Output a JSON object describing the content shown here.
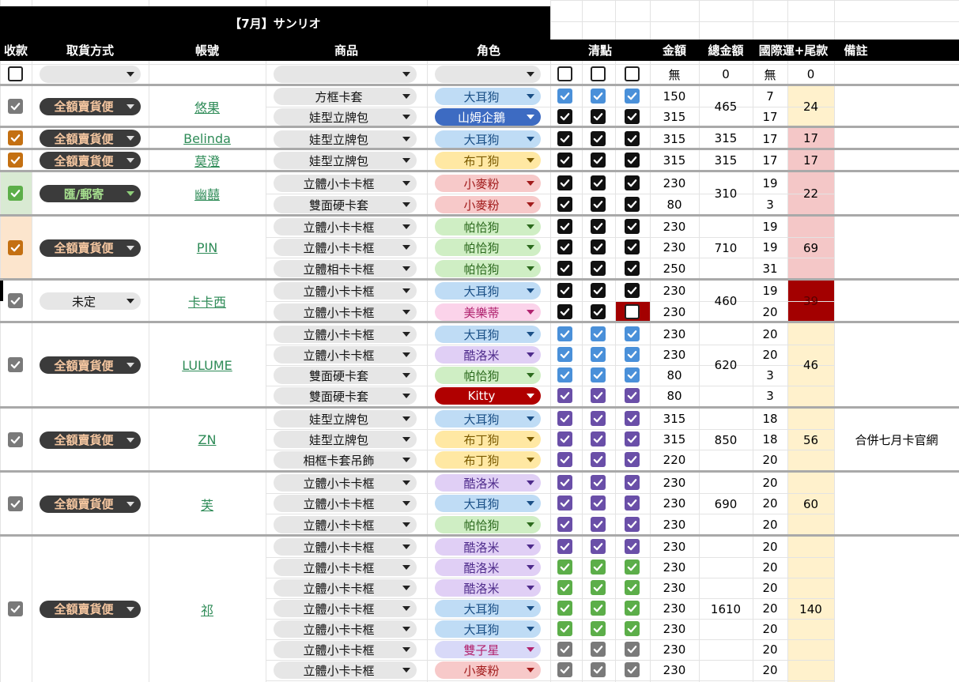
{
  "title": "【7月】サンリオ",
  "headers": [
    "收款",
    "取貨方式",
    "帳號",
    "商品",
    "角色",
    "清點",
    "金額",
    "總金額",
    "國際運+尾款",
    "備註"
  ],
  "empty_row": {
    "amount": "無",
    "total": "0",
    "shipping": "無",
    "tail": "0"
  },
  "colors": {
    "blue": "#4a90d9",
    "purple": "#6a4fa8",
    "green": "#5cae49",
    "black": "#111",
    "gray": "#7a7a7a",
    "orange": "#c47012",
    "yellow_bg": "#fff1cc",
    "pink_bg": "#f4c7c7",
    "red_bg": "#a30000"
  },
  "groups": [
    {
      "paid": "gray",
      "paid_bg": "",
      "pickup": "全額賣貨便",
      "pickup_style": "dark",
      "account": "悠果",
      "total": "465",
      "tail": "24",
      "tail_style": "yellow",
      "note": "",
      "items": [
        {
          "product": "方框卡套",
          "role": "大耳狗",
          "role_style": "blue",
          "checks": [
            "blue",
            "blue",
            "blue"
          ],
          "amount": "150",
          "ship": "7"
        },
        {
          "product": "娃型立牌包",
          "role": "山姆企鵝",
          "role_style": "darkblue",
          "checks": [
            "black",
            "black",
            "black"
          ],
          "amount": "315",
          "ship": "17"
        }
      ]
    },
    {
      "paid": "orange",
      "paid_bg": "",
      "pickup": "全額賣貨便",
      "pickup_style": "dark",
      "account": "Belinda",
      "total": "315",
      "tail": "17",
      "tail_style": "pink",
      "note": "",
      "items": [
        {
          "product": "娃型立牌包",
          "role": "大耳狗",
          "role_style": "blue",
          "checks": [
            "black",
            "black",
            "black"
          ],
          "amount": "315",
          "ship": "17"
        }
      ]
    },
    {
      "paid": "orange",
      "paid_bg": "",
      "pickup": "全額賣貨便",
      "pickup_style": "dark",
      "account": "莫澄",
      "total": "315",
      "tail": "17",
      "tail_style": "pink",
      "note": "",
      "items": [
        {
          "product": "娃型立牌包",
          "role": "布丁狗",
          "role_style": "yellow",
          "checks": [
            "black",
            "black",
            "black"
          ],
          "amount": "315",
          "ship": "17"
        }
      ]
    },
    {
      "paid": "green",
      "paid_bg": "#d9ead3",
      "pickup": "匯/郵寄",
      "pickup_style": "darkgreen",
      "account": "幽囍",
      "total": "310",
      "tail": "22",
      "tail_style": "pink",
      "note": "",
      "items": [
        {
          "product": "立體小卡卡框",
          "role": "小麥粉",
          "role_style": "pink",
          "checks": [
            "black",
            "black",
            "black"
          ],
          "amount": "230",
          "ship": "19"
        },
        {
          "product": "雙面硬卡套",
          "role": "小麥粉",
          "role_style": "pink",
          "checks": [
            "black",
            "black",
            "black"
          ],
          "amount": "80",
          "ship": "3"
        }
      ]
    },
    {
      "paid": "orange",
      "paid_bg": "#fce5cd",
      "pickup": "全額賣貨便",
      "pickup_style": "dark",
      "account": "PIN",
      "total": "710",
      "tail": "69",
      "tail_style": "pink",
      "note": "",
      "items": [
        {
          "product": "立體小卡卡框",
          "role": "帕恰狗",
          "role_style": "green",
          "checks": [
            "black",
            "black",
            "black"
          ],
          "amount": "230",
          "ship": "19"
        },
        {
          "product": "立體小卡卡框",
          "role": "帕恰狗",
          "role_style": "green",
          "checks": [
            "black",
            "black",
            "black"
          ],
          "amount": "230",
          "ship": "19"
        },
        {
          "product": "立體相卡卡框",
          "role": "帕恰狗",
          "role_style": "green",
          "checks": [
            "black",
            "black",
            "black"
          ],
          "amount": "250",
          "ship": "31"
        }
      ]
    },
    {
      "paid": "gray",
      "paid_bg": "",
      "pickup": "未定",
      "pickup_style": "light",
      "account": "卡卡西",
      "total": "460",
      "tail": "39",
      "tail_style": "red",
      "note": "",
      "items": [
        {
          "product": "立體小卡卡框",
          "role": "大耳狗",
          "role_style": "blue",
          "checks": [
            "black",
            "black",
            "black"
          ],
          "amount": "230",
          "ship": "19"
        },
        {
          "product": "立體小卡卡框",
          "role": "美樂蒂",
          "role_style": "lightpink",
          "checks": [
            "black",
            "black",
            "redoff"
          ],
          "amount": "230",
          "ship": "20"
        }
      ]
    },
    {
      "paid": "gray",
      "paid_bg": "",
      "pickup": "全額賣貨便",
      "pickup_style": "dark",
      "account": "LULUME",
      "total": "620",
      "tail": "46",
      "tail_style": "yellow",
      "note": "",
      "items": [
        {
          "product": "立體小卡卡框",
          "role": "大耳狗",
          "role_style": "blue",
          "checks": [
            "blue",
            "blue",
            "blue"
          ],
          "amount": "230",
          "ship": "20"
        },
        {
          "product": "立體小卡卡框",
          "role": "酷洛米",
          "role_style": "purple",
          "checks": [
            "blue",
            "blue",
            "blue"
          ],
          "amount": "230",
          "ship": "20"
        },
        {
          "product": "雙面硬卡套",
          "role": "帕恰狗",
          "role_style": "green",
          "checks": [
            "blue",
            "blue",
            "blue"
          ],
          "amount": "80",
          "ship": "3"
        },
        {
          "product": "雙面硬卡套",
          "role": "Kitty",
          "role_style": "red",
          "checks": [
            "purple",
            "purple",
            "purple"
          ],
          "amount": "80",
          "ship": "3"
        }
      ]
    },
    {
      "paid": "gray",
      "paid_bg": "",
      "pickup": "全額賣貨便",
      "pickup_style": "dark",
      "account": "ZN",
      "total": "850",
      "tail": "56",
      "tail_style": "yellow",
      "note": "合併七月卡官網",
      "items": [
        {
          "product": "娃型立牌包",
          "role": "大耳狗",
          "role_style": "blue",
          "checks": [
            "purple",
            "purple",
            "purple"
          ],
          "amount": "315",
          "ship": "18"
        },
        {
          "product": "娃型立牌包",
          "role": "布丁狗",
          "role_style": "yellow",
          "checks": [
            "purple",
            "purple",
            "purple"
          ],
          "amount": "315",
          "ship": "18"
        },
        {
          "product": "相框卡套吊飾",
          "role": "布丁狗",
          "role_style": "yellow",
          "checks": [
            "purple",
            "purple",
            "purple"
          ],
          "amount": "220",
          "ship": "20"
        }
      ]
    },
    {
      "paid": "gray",
      "paid_bg": "",
      "pickup": "全額賣貨便",
      "pickup_style": "dark",
      "account": "芙",
      "total": "690",
      "tail": "60",
      "tail_style": "yellow",
      "note": "",
      "items": [
        {
          "product": "立體小卡卡框",
          "role": "酷洛米",
          "role_style": "purple",
          "checks": [
            "purple",
            "purple",
            "purple"
          ],
          "amount": "230",
          "ship": "20"
        },
        {
          "product": "立體小卡卡框",
          "role": "大耳狗",
          "role_style": "blue",
          "checks": [
            "purple",
            "purple",
            "purple"
          ],
          "amount": "230",
          "ship": "20"
        },
        {
          "product": "立體小卡卡框",
          "role": "帕恰狗",
          "role_style": "green",
          "checks": [
            "purple",
            "purple",
            "purple"
          ],
          "amount": "230",
          "ship": "20"
        }
      ]
    },
    {
      "paid": "gray",
      "paid_bg": "",
      "pickup": "全額賣貨便",
      "pickup_style": "dark",
      "account": "祁",
      "total": "1610",
      "tail": "140",
      "tail_style": "yellow",
      "note": "",
      "items": [
        {
          "product": "立體小卡卡框",
          "role": "酷洛米",
          "role_style": "purple",
          "checks": [
            "purple",
            "purple",
            "purple"
          ],
          "amount": "230",
          "ship": "20"
        },
        {
          "product": "立體小卡卡框",
          "role": "酷洛米",
          "role_style": "purple",
          "checks": [
            "green",
            "green",
            "green"
          ],
          "amount": "230",
          "ship": "20"
        },
        {
          "product": "立體小卡卡框",
          "role": "酷洛米",
          "role_style": "purple",
          "checks": [
            "green",
            "green",
            "green"
          ],
          "amount": "230",
          "ship": "20"
        },
        {
          "product": "立體小卡卡框",
          "role": "大耳狗",
          "role_style": "blue",
          "checks": [
            "green",
            "green",
            "green"
          ],
          "amount": "230",
          "ship": "20"
        },
        {
          "product": "立體小卡卡框",
          "role": "大耳狗",
          "role_style": "blue",
          "checks": [
            "green",
            "green",
            "green"
          ],
          "amount": "230",
          "ship": "20"
        },
        {
          "product": "立體小卡卡框",
          "role": "雙子星",
          "role_style": "lavender",
          "checks": [
            "gray",
            "gray",
            "gray"
          ],
          "amount": "230",
          "ship": "20"
        },
        {
          "product": "立體小卡卡框",
          "role": "小麥粉",
          "role_style": "pink",
          "checks": [
            "gray",
            "gray",
            "gray"
          ],
          "amount": "230",
          "ship": "20"
        }
      ]
    }
  ]
}
